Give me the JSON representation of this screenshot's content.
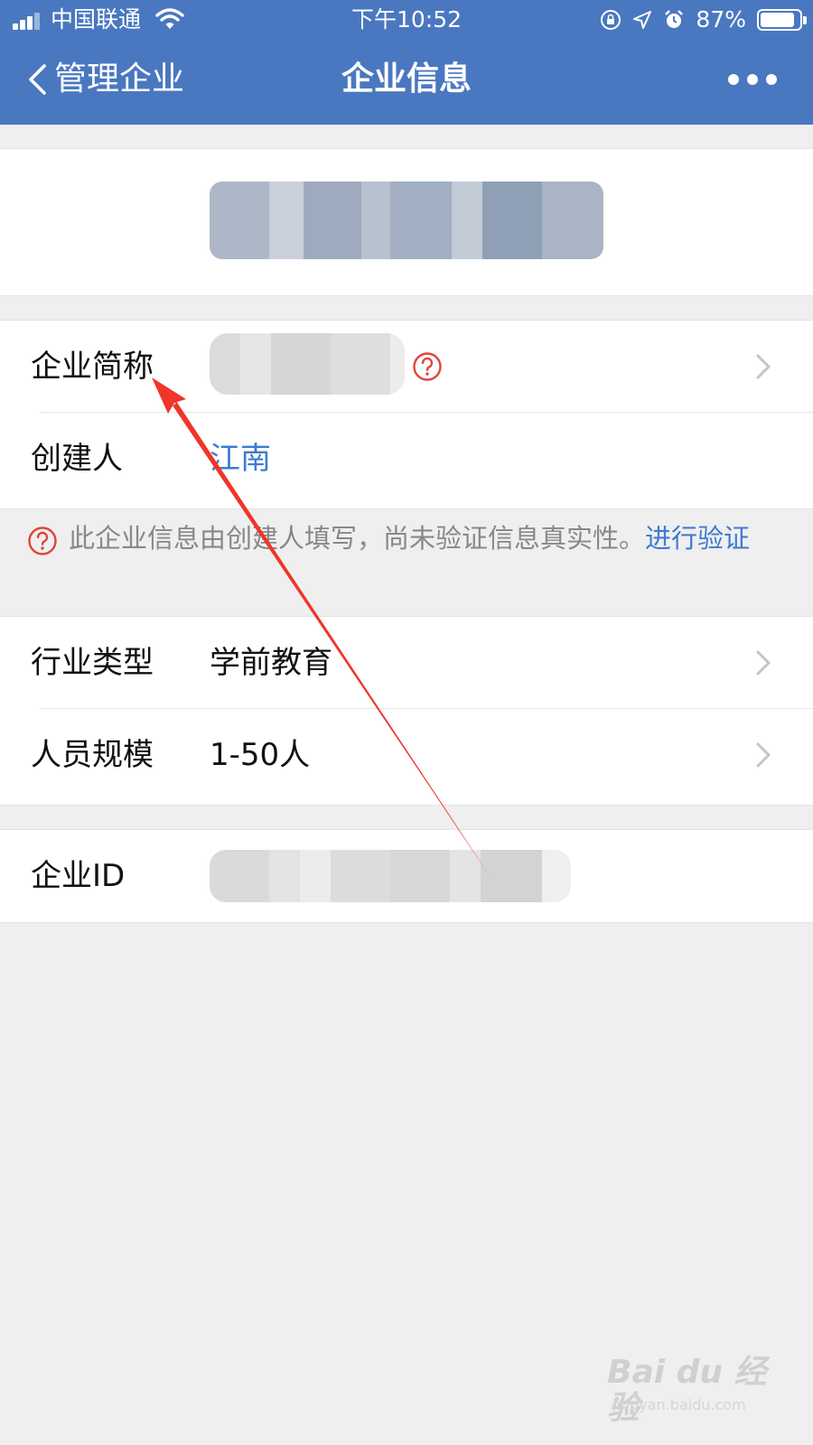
{
  "status_bar": {
    "carrier": "中国联通",
    "time": "下午10:52",
    "battery_percent": "87%",
    "battery_level": 0.87,
    "icons": [
      "signal-icon",
      "wifi-icon",
      "orientation-lock-icon",
      "location-icon",
      "alarm-icon",
      "battery-icon"
    ]
  },
  "nav": {
    "back_label": "管理企业",
    "title": "企业信息",
    "more_icon": "more-dots-icon"
  },
  "rows": {
    "short_name": {
      "label": "企业简称",
      "value_redacted": true
    },
    "creator": {
      "label": "创建人",
      "value": "江南"
    },
    "industry": {
      "label": "行业类型",
      "value": "学前教育"
    },
    "size": {
      "label": "人员规模",
      "value": "1-50人"
    },
    "company_id": {
      "label": "企业ID",
      "value_redacted": true
    }
  },
  "notice": {
    "text": "此企业信息由创建人填写，尚未验证信息真实性。",
    "link": "进行验证"
  },
  "watermark": {
    "logo": "Bai du 经验",
    "url": "jingyan.baidu.com"
  },
  "colors": {
    "header": "#4a78c0",
    "link": "#3e7bd1",
    "question": "#e0453c",
    "arrow": "#f0352a"
  }
}
